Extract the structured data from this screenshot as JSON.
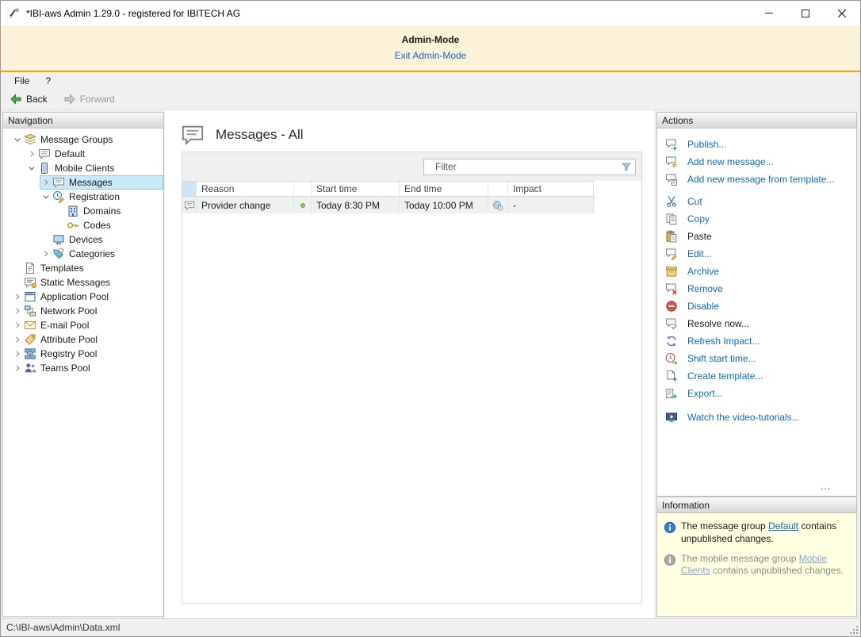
{
  "window": {
    "title": "*IBI-aws Admin 1.29.0 - registered for IBITECH AG"
  },
  "admin_banner": {
    "title": "Admin-Mode",
    "exit_link": "Exit Admin-Mode"
  },
  "menu": {
    "items": [
      {
        "label": "File"
      },
      {
        "label": "?"
      }
    ]
  },
  "toolbar": {
    "back": "Back",
    "forward": "Forward"
  },
  "navigation": {
    "header": "Navigation",
    "tree": [
      {
        "label": "Message Groups",
        "depth": 0,
        "state": "expanded",
        "icon": "message-groups-icon",
        "selected": false
      },
      {
        "label": "Default",
        "depth": 1,
        "state": "collapsed",
        "icon": "message-group-icon",
        "selected": false
      },
      {
        "label": "Mobile Clients",
        "depth": 1,
        "state": "expanded",
        "icon": "mobile-clients-icon",
        "selected": false
      },
      {
        "label": "Messages",
        "depth": 2,
        "state": "collapsed",
        "icon": "messages-icon",
        "selected": true
      },
      {
        "label": "Registration",
        "depth": 2,
        "state": "expanded",
        "icon": "registration-icon",
        "selected": false
      },
      {
        "label": "Domains",
        "depth": 3,
        "state": "leaf",
        "icon": "domains-icon",
        "selected": false
      },
      {
        "label": "Codes",
        "depth": 3,
        "state": "leaf",
        "icon": "codes-icon",
        "selected": false
      },
      {
        "label": "Devices",
        "depth": 2,
        "state": "leaf",
        "icon": "devices-icon",
        "selected": false
      },
      {
        "label": "Categories",
        "depth": 2,
        "state": "collapsed",
        "icon": "categories-icon",
        "selected": false
      },
      {
        "label": "Templates",
        "depth": 0,
        "state": "leaf",
        "icon": "templates-icon",
        "selected": false
      },
      {
        "label": "Static Messages",
        "depth": 0,
        "state": "leaf",
        "icon": "static-messages-icon",
        "selected": false
      },
      {
        "label": "Application Pool",
        "depth": 0,
        "state": "collapsed",
        "icon": "application-pool-icon",
        "selected": false
      },
      {
        "label": "Network Pool",
        "depth": 0,
        "state": "collapsed",
        "icon": "network-pool-icon",
        "selected": false
      },
      {
        "label": "E-mail Pool",
        "depth": 0,
        "state": "collapsed",
        "icon": "email-pool-icon",
        "selected": false
      },
      {
        "label": "Attribute Pool",
        "depth": 0,
        "state": "collapsed",
        "icon": "attribute-pool-icon",
        "selected": false
      },
      {
        "label": "Registry Pool",
        "depth": 0,
        "state": "collapsed",
        "icon": "registry-pool-icon",
        "selected": false
      },
      {
        "label": "Teams Pool",
        "depth": 0,
        "state": "collapsed",
        "icon": "teams-pool-icon",
        "selected": false
      }
    ]
  },
  "main": {
    "title": "Messages - All",
    "filter_placeholder": "Filter",
    "table": {
      "columns": [
        "",
        "Reason",
        "",
        "Start time",
        "End time",
        "",
        "Impact"
      ],
      "rows": [
        {
          "reason": "Provider change",
          "status": "active",
          "start_time": "Today 8:30 PM",
          "end_time": "Today 10:00 PM",
          "impact": "-"
        }
      ]
    }
  },
  "actions": {
    "header": "Actions",
    "overflow": "...",
    "items": [
      {
        "label": "Publish...",
        "enabled": true
      },
      {
        "label": "Add new message...",
        "enabled": true
      },
      {
        "label": "Add new message from template...",
        "enabled": true
      },
      {
        "label": "Cut",
        "enabled": true
      },
      {
        "label": "Copy",
        "enabled": true
      },
      {
        "label": "Paste",
        "enabled": false
      },
      {
        "label": "Edit...",
        "enabled": true
      },
      {
        "label": "Archive",
        "enabled": true
      },
      {
        "label": "Remove",
        "enabled": true
      },
      {
        "label": "Disable",
        "enabled": true
      },
      {
        "label": "Resolve now...",
        "enabled": false
      },
      {
        "label": "Refresh Impact...",
        "enabled": true
      },
      {
        "label": "Shift start time...",
        "enabled": true
      },
      {
        "label": "Create template...",
        "enabled": true
      },
      {
        "label": "Export...",
        "enabled": true
      },
      {
        "label": "Watch the video-tutorials...",
        "enabled": true
      }
    ]
  },
  "information": {
    "header": "Information",
    "items": [
      {
        "prefix": "The message group ",
        "link": "Default",
        "suffix": " contains unpublished changes."
      },
      {
        "prefix": "The mobile message group ",
        "link": "Mobile Clients",
        "suffix": " contains unpublished changes."
      }
    ]
  },
  "statusbar": {
    "path": "C:\\IBI-aws\\Admin\\Data.xml"
  },
  "colors": {
    "link": "#0d6cbd",
    "banner_bg": "#fcf2da",
    "banner_border": "#f0a30a",
    "selection_bg": "#cbe8f6",
    "info_bg": "#ffffe1"
  }
}
